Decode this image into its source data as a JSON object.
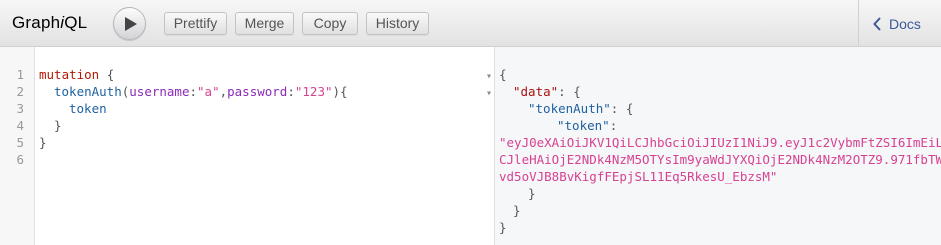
{
  "toolbar": {
    "logo_prefix": "Graph",
    "logo_italic": "i",
    "logo_suffix": "QL",
    "prettify_label": "Prettify",
    "merge_label": "Merge",
    "copy_label": "Copy",
    "history_label": "History",
    "docs_label": "Docs"
  },
  "query_editor": {
    "line_numbers": [
      "1",
      "2",
      "3",
      "4",
      "5",
      "6"
    ],
    "keyword": "mutation",
    "open_brace": " {",
    "field": "tokenAuth",
    "paren_open": "(",
    "arg1_name": "username",
    "colon": ":",
    "arg1_value": "\"a\"",
    "comma": ",",
    "arg2_name": "password",
    "arg2_value": "\"123\"",
    "paren_close_brace": "){",
    "subfield": "token",
    "close_inner": "}",
    "close_outer": "}"
  },
  "result": {
    "open_brace": "{",
    "data_key": "\"data\"",
    "tokenauth_key": "\"tokenAuth\"",
    "token_key": "\"token\"",
    "colon_brace": ": {",
    "colon": ":",
    "token_line1": "\"eyJ0eXAiOiJKV1QiLCJhbGciOiJIUzI1NiJ9.eyJ1c2VybmFtZSI6ImEiL",
    "token_line2": "CJleHAiOjE2NDk4NzM5OTYsIm9yaWdJYXQiOjE2NDk4NzM2OTZ9.971fbTW",
    "token_line3": "vd5oVJB8BvKigfFEpjSL11Eq5RkesU_EbzsM\"",
    "close1": "}",
    "close2": "}",
    "close3": "}"
  },
  "icons": {
    "play": "play-icon",
    "docs_chevron": "chevron-left-icon",
    "fold": "fold-arrow-icon"
  },
  "colors": {
    "keyword": "#b11a04",
    "field": "#1f61a0",
    "argument": "#8b2bb9",
    "string": "#d64292",
    "docs_link": "#3b5998"
  }
}
